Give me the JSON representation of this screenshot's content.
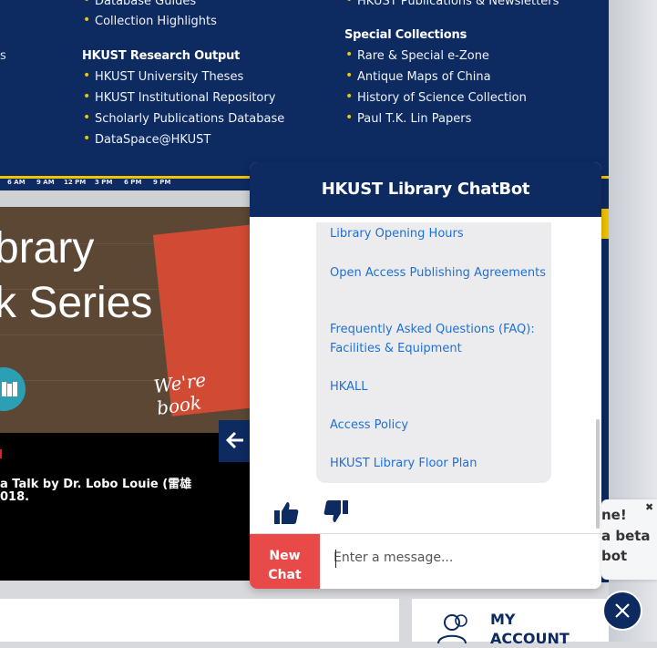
{
  "nav": {
    "left_partial_item": "Database Guides",
    "left_items_top": [
      "Collection Highlights"
    ],
    "edge_fragment": "s",
    "research_title": "HKUST Research Output",
    "research_items": [
      "HKUST University Theses",
      "HKUST Institutional Repository",
      "Scholarly Publications Database",
      "DataSpace@HKUST"
    ],
    "right_partial_item": "HKUST Publications & Newsletters",
    "special_title": "Special Collections",
    "special_items": [
      "Rare & Special e-Zone",
      "Antique Maps of China",
      "History of Science Collection",
      "Paul T.K. Lin Papers"
    ]
  },
  "timeline": [
    "6 AM",
    "9 AM",
    "12 PM",
    "3 PM",
    "6 PM",
    "9 PM"
  ],
  "hero": {
    "line1": "brary",
    "line2": "k Series",
    "book_text": "We're book",
    "caption_line1": "a Talk by Dr. Lobo Louie (雷雄",
    "caption_line2": "018."
  },
  "account": {
    "line1": "MY",
    "line2": "ACCOUNT"
  },
  "chat": {
    "title": "HKUST Library ChatBot",
    "links": [
      "Library Opening Hours",
      "Open Access Publishing Agreements",
      "Frequently Asked Questions (FAQ): Facilities & Equipment",
      "HKALL",
      "Access Policy",
      "HKUST Library Floor Plan"
    ],
    "new_chat_line1": "New",
    "new_chat_line2": "Chat",
    "input_placeholder": "Enter a message..."
  },
  "popup": {
    "line1": "ne!",
    "line2": "a beta",
    "line3": "bot",
    "close_glyph": "✖"
  },
  "colors": {
    "navy": "#0d2a61",
    "accent_yellow": "#f2c500",
    "link": "#1f70d6",
    "new_chat_red": "#e84a4a"
  }
}
